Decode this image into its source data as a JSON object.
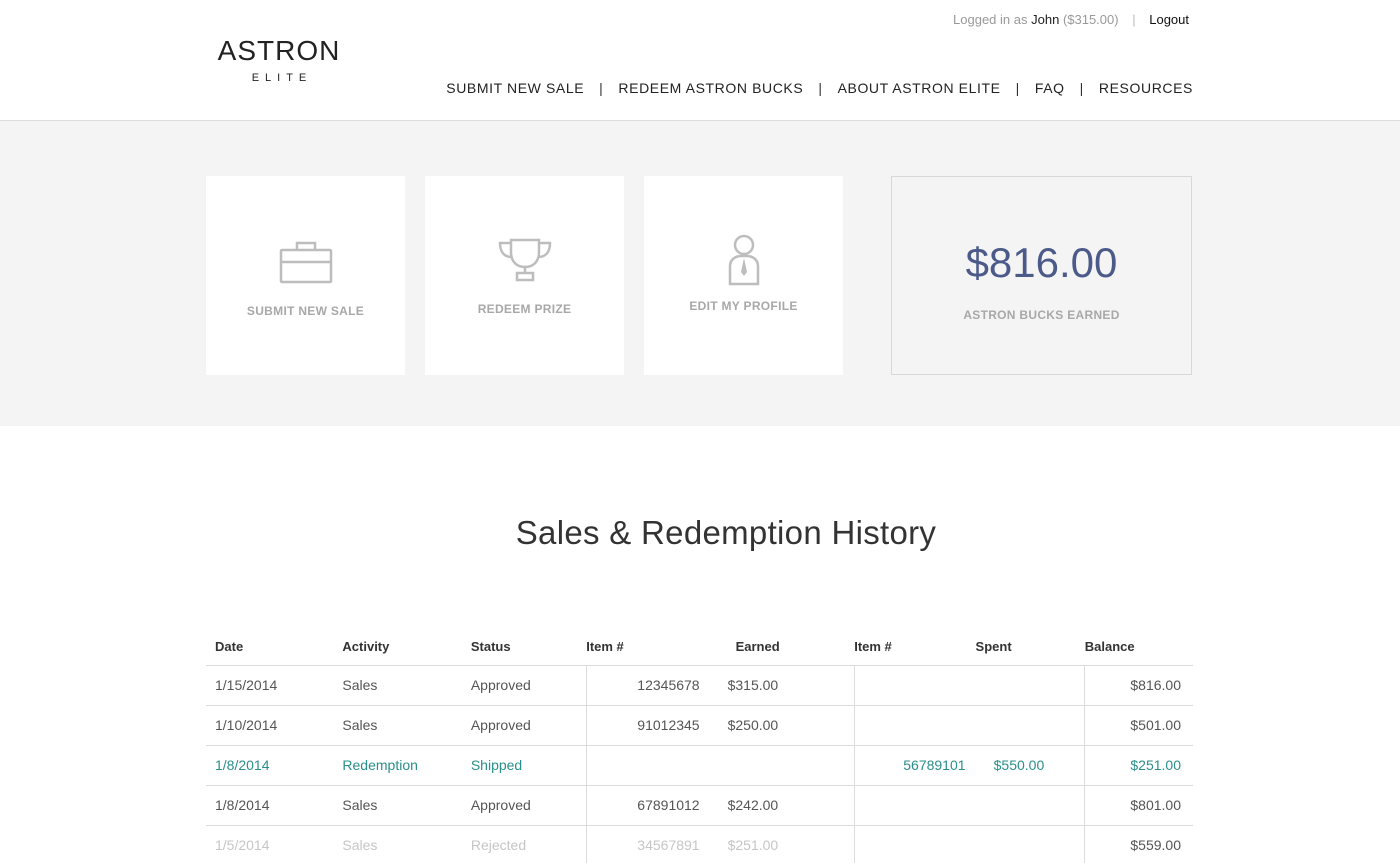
{
  "brand": {
    "name": "ASTRON",
    "sub": "ELITE"
  },
  "userbar": {
    "prefix": "Logged in as",
    "username": "John",
    "balance": "($315.00)",
    "separator": "|",
    "logout": "Logout"
  },
  "nav": {
    "items": [
      "SUBMIT NEW SALE",
      "REDEEM ASTRON BUCKS",
      "ABOUT ASTRON ELITE",
      "FAQ",
      "RESOURCES"
    ],
    "separator": "|"
  },
  "tiles": [
    {
      "label": "SUBMIT NEW SALE",
      "icon": "briefcase-icon"
    },
    {
      "label": "REDEEM PRIZE",
      "icon": "trophy-icon"
    },
    {
      "label": "EDIT MY PROFILE",
      "icon": "person-icon"
    }
  ],
  "earned": {
    "amount": "$816.00",
    "label": "ASTRON BUCKS EARNED",
    "color": "#4c5a8a"
  },
  "history": {
    "title": "Sales & Redemption History",
    "columns": {
      "date": "Date",
      "activity": "Activity",
      "status": "Status",
      "item": "Item #",
      "earned": "Earned",
      "ritem": "Item #",
      "spent": "Spent",
      "balance": "Balance"
    },
    "rows": [
      {
        "date": "1/15/2014",
        "activity": "Sales",
        "status": "Approved",
        "item": "12345678",
        "earned": "$315.00",
        "ritem": "",
        "spent": "",
        "balance": "$816.00"
      },
      {
        "date": "1/10/2014",
        "activity": "Sales",
        "status": "Approved",
        "item": "91012345",
        "earned": "$250.00",
        "ritem": "",
        "spent": "",
        "balance": "$501.00"
      },
      {
        "date": "1/8/2014",
        "activity": "Redemption",
        "status": "Shipped",
        "item": "",
        "earned": "",
        "ritem": "56789101",
        "spent": "$550.00",
        "balance": "$251.00"
      },
      {
        "date": "1/8/2014",
        "activity": "Sales",
        "status": "Approved",
        "item": "67891012",
        "earned": "$242.00",
        "ritem": "",
        "spent": "",
        "balance": "$801.00"
      },
      {
        "date": "1/5/2014",
        "activity": "Sales",
        "status": "Rejected",
        "item": "34567891",
        "earned": "$251.00",
        "ritem": "",
        "spent": "",
        "balance": "$559.00"
      }
    ],
    "colors": {
      "redemption": "#2a8f8a",
      "rejected": "#c6c6c6"
    }
  }
}
